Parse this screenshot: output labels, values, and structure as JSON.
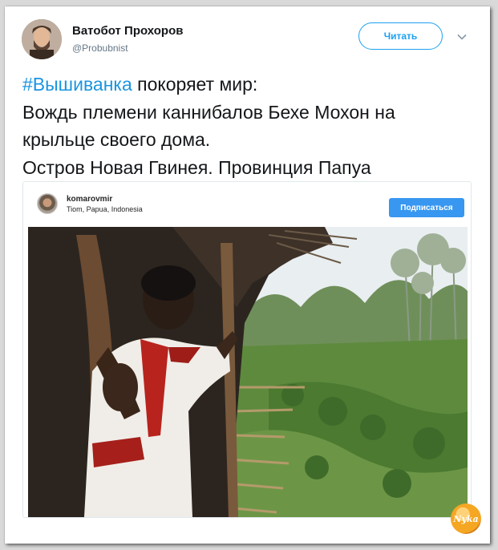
{
  "author": {
    "name": "Ватобот Прохоров",
    "handle": "@Probubnist"
  },
  "actions": {
    "follow_label": "Читать"
  },
  "tweet": {
    "hashtag": "#Вышиванка",
    "line1_rest": " покоряет мир:",
    "line2": "Вождь племени каннибалов Бехе Мохон на",
    "line3": "крыльце своего дома.",
    "line4": "Остров Новая Гвинея. Провинция Папуа"
  },
  "embed": {
    "username": "komarovmir",
    "location": "Tiom, Papua, Indonesia",
    "subscribe_label": "Подписаться"
  },
  "watermark": {
    "text": "Nyka"
  },
  "colors": {
    "accent": "#1da1f2",
    "hashtag": "#1b95e0",
    "instagram_button": "#3897f0"
  },
  "icons": {
    "more": "chevron-down-icon"
  }
}
